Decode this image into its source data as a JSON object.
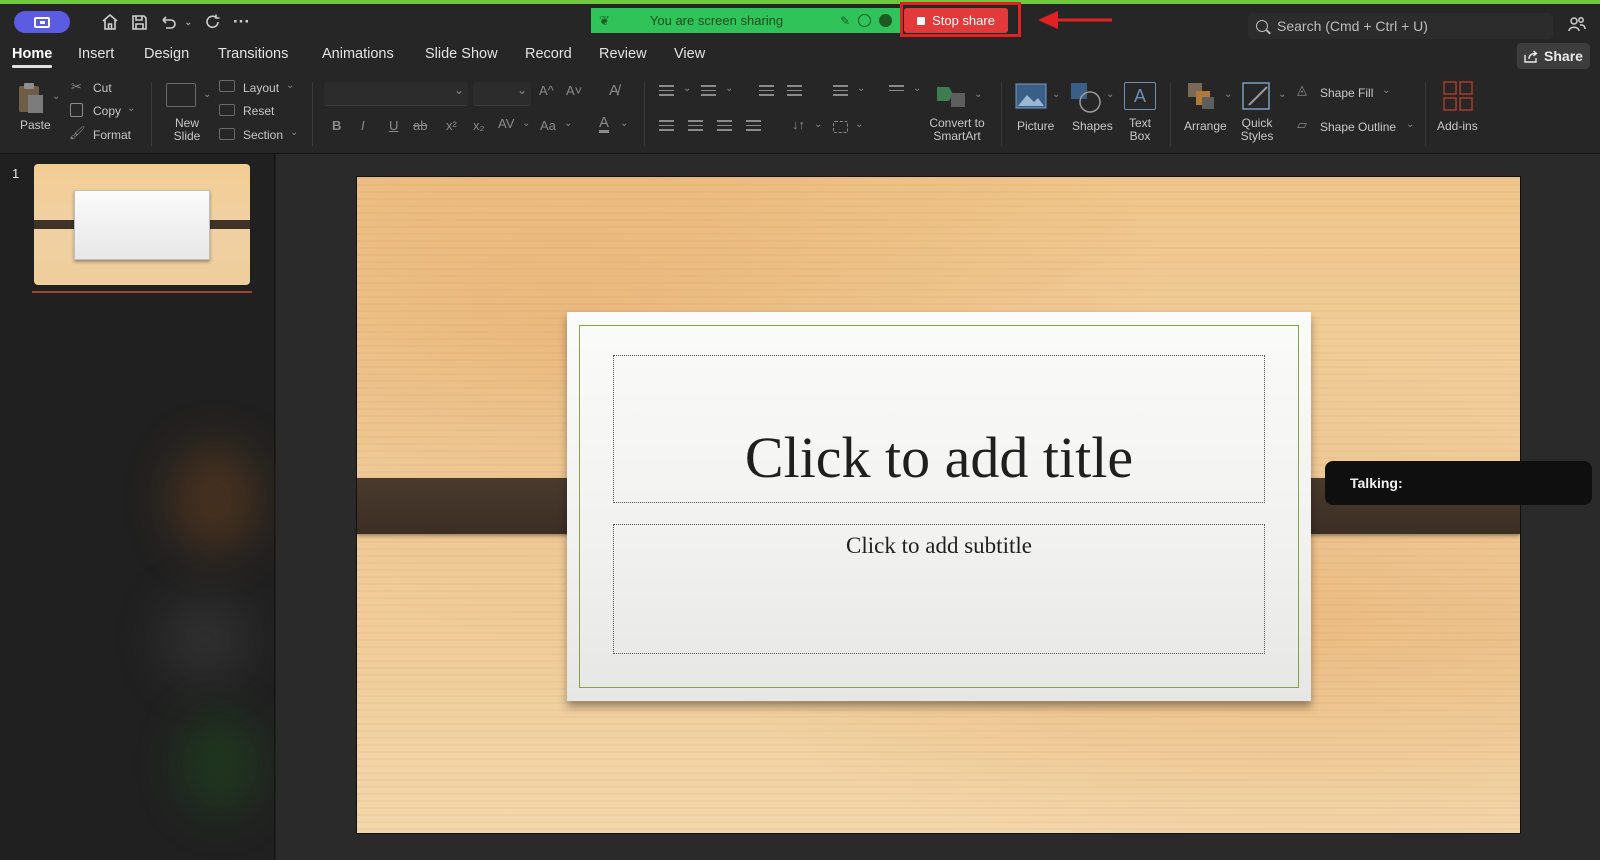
{
  "titlebar": {
    "more_label": "···",
    "share_banner": "You are screen sharing",
    "stop_share_label": "Stop share",
    "search_placeholder": "Search (Cmd + Ctrl + U)"
  },
  "tabs": [
    "Home",
    "Insert",
    "Design",
    "Transitions",
    "Animations",
    "Slide Show",
    "Record",
    "Review",
    "View"
  ],
  "active_tab": "Home",
  "share_button": "Share",
  "ribbon": {
    "clipboard": {
      "paste": "Paste",
      "cut": "Cut",
      "copy": "Copy",
      "format": "Format"
    },
    "slides": {
      "new_slide_1": "New",
      "new_slide_2": "Slide",
      "layout": "Layout",
      "reset": "Reset",
      "section": "Section"
    },
    "font": {
      "bold": "B",
      "italic": "I",
      "underline": "U",
      "strike": "ab",
      "superscript": "x²",
      "subscript": "x₂",
      "spacing": "AV",
      "case": "Aa",
      "font_color": "A",
      "grow": "A^",
      "shrink": "A˅"
    },
    "smartart": {
      "label_1": "Convert to",
      "label_2": "SmartArt"
    },
    "insert": {
      "picture": "Picture",
      "shapes": "Shapes",
      "textbox_1": "Text",
      "textbox_2": "Box"
    },
    "drawing": {
      "arrange": "Arrange",
      "quick_1": "Quick",
      "quick_2": "Styles",
      "shape_fill": "Shape Fill",
      "shape_outline": "Shape Outline"
    },
    "addins": "Add-ins"
  },
  "thumbnails": [
    {
      "number": "1"
    }
  ],
  "slide": {
    "title_placeholder": "Click to add title",
    "subtitle_placeholder": "Click to add subtitle"
  },
  "talking_label": "Talking:",
  "colors": {
    "share_banner": "#2fc35a",
    "stop_share": "#e23a3a",
    "annotation": "#e22222",
    "accent_pill": "#5b5ce2"
  },
  "icons": [
    "home-icon",
    "save-icon",
    "undo-icon",
    "redo-icon",
    "search-icon",
    "people-icon",
    "share-icon",
    "paste-icon",
    "scissors-icon",
    "copy-icon",
    "brush-icon",
    "picture-icon",
    "shapes-icon",
    "textbox-icon",
    "arrange-icon",
    "quick-styles-icon",
    "shape-fill-icon",
    "shape-outline-icon",
    "addins-icon"
  ]
}
